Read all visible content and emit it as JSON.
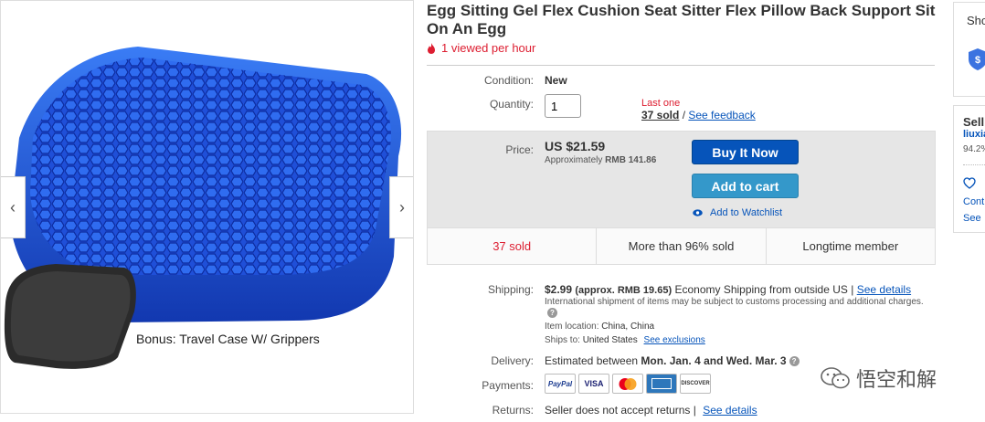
{
  "product": {
    "title": "Egg Sitting Gel Flex Cushion Seat Sitter Flex Pillow Back Support Sit On An Egg",
    "viewed": "1 viewed per hour",
    "image_caption": "Bonus: Travel Case W/ Grippers"
  },
  "condition": {
    "label": "Condition:",
    "value": "New"
  },
  "quantity": {
    "label": "Quantity:",
    "value": "1",
    "last_one": "Last one",
    "sold": "37 sold",
    "separator": " / ",
    "feedback_link": "See feedback"
  },
  "price": {
    "label": "Price:",
    "amount": "US $21.59",
    "approx_prefix": "Approximately",
    "approx_value": "RMB 141.86",
    "buy_button": "Buy It Now",
    "cart_button": "Add to cart",
    "watchlist": "Add to Watchlist"
  },
  "stats": [
    "37 sold",
    "More than 96% sold",
    "Longtime member"
  ],
  "shipping": {
    "label": "Shipping:",
    "cost": "$2.99",
    "approx": "(approx. RMB 19.65)",
    "method": "Economy Shipping from outside US |",
    "details_link": "See details",
    "note": "International shipment of items may be subject to customs processing and additional charges.",
    "location_label": "Item location:",
    "location": "China, China",
    "ships_label": "Ships to:",
    "ships_to": "United States",
    "exclusions_link": "See exclusions"
  },
  "delivery": {
    "label": "Delivery:",
    "prefix": "Estimated between",
    "range": "Mon. Jan. 4 and Wed. Mar. 3"
  },
  "payments": {
    "label": "Payments:",
    "methods": [
      "PayPal",
      "VISA",
      "MasterCard",
      "AmEx",
      "DISCOVER"
    ]
  },
  "returns": {
    "label": "Returns:",
    "text": "Seller does not accept returns |",
    "details_link": "See details"
  },
  "side": {
    "top_label": "Sho",
    "seller_label": "Sell",
    "seller_name": "liuxia",
    "seller_pct": "94.2%",
    "contact": "Cont",
    "see": "See"
  },
  "watermark": "悟空和解",
  "colors": {
    "link": "#0654ba",
    "red": "#dd1e31",
    "buy": "#0654ba",
    "cart": "#3498ca"
  }
}
